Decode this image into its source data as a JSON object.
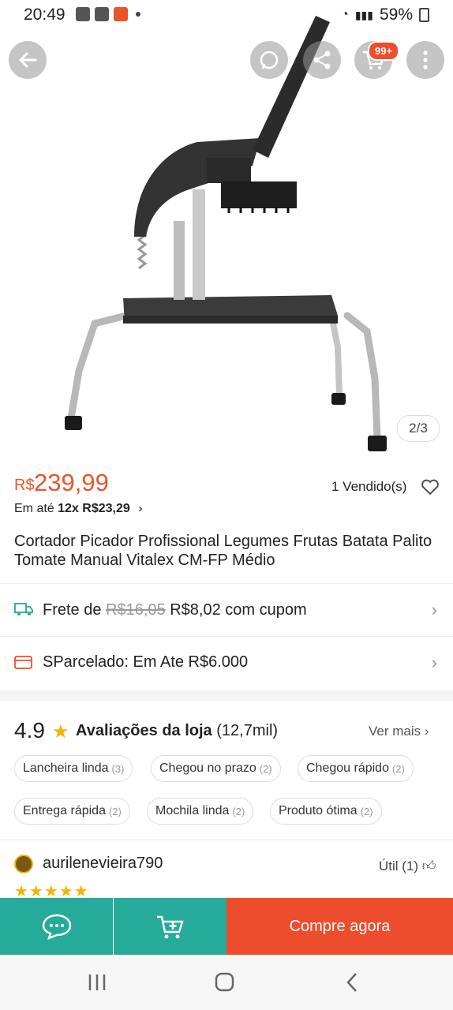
{
  "status_bar": {
    "time": "20:49",
    "battery": "59%"
  },
  "hero": {
    "image_counter": "2/3",
    "cart_badge": "99+"
  },
  "product": {
    "currency": "R$",
    "price": "239,99",
    "sold": "1 Vendido(s)",
    "installment_prefix": "Em até",
    "installment_value": "12x R$23,29",
    "title": "Cortador Picador Profissional Legumes Frutas Batata Palito Tomate Manual Vitalex CM-FP Médio"
  },
  "shipping": {
    "prefix": "Frete de",
    "old_price": "R$16,05",
    "new_price": "R$8,02 com cupom"
  },
  "sparcelado": {
    "text": "SParcelado: Em Ate R$6.000"
  },
  "reviews": {
    "score": "4.9",
    "label": "Avaliações da loja",
    "count": "(12,7mil)",
    "see_more": "Ver mais",
    "tags": [
      {
        "label": "Lancheira linda",
        "count": "(3)"
      },
      {
        "label": "Chegou no prazo",
        "count": "(2)"
      },
      {
        "label": "Chegou rápido",
        "count": "(2)"
      },
      {
        "label": "Entrega rápida",
        "count": "(2)"
      },
      {
        "label": "Mochila linda",
        "count": "(2)"
      },
      {
        "label": "Produto ótima",
        "count": "(2)"
      }
    ],
    "first_review": {
      "username": "aurilenevieira790",
      "helpful": "Útil (1)",
      "stars": 5
    }
  },
  "actions": {
    "buy_now": "Compre agora"
  },
  "colors": {
    "accent": "#ee4d2d",
    "teal": "#26aa99",
    "star": "#f5b400"
  },
  "icons": [
    "back-arrow-icon",
    "whatsapp-icon",
    "share-icon",
    "cart-icon",
    "more-vertical-icon",
    "heart-icon",
    "truck-icon",
    "credit-card-icon",
    "star-icon",
    "thumbs-up-icon",
    "chat-icon",
    "add-to-cart-icon"
  ]
}
